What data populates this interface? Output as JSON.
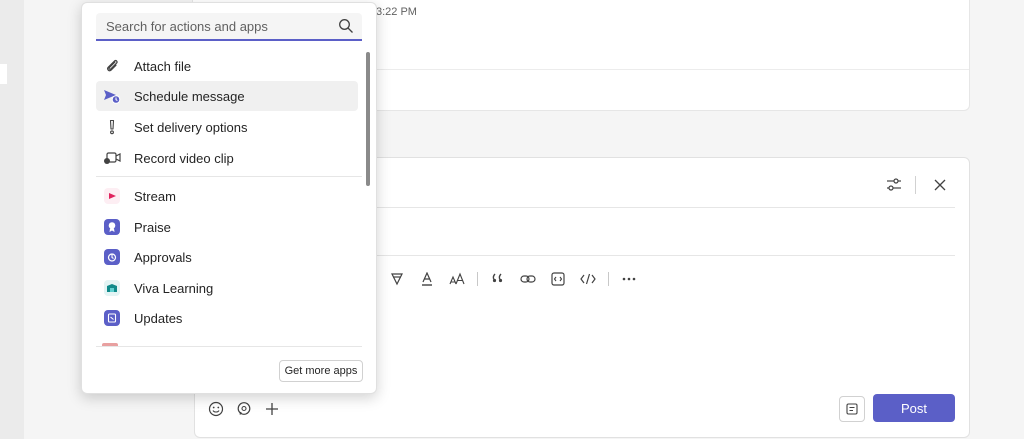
{
  "background": {
    "timestamp": "3:22 PM"
  },
  "popup": {
    "search_placeholder": "Search for actions and apps",
    "actions": [
      {
        "label": "Attach file",
        "icon": "paperclip-icon"
      },
      {
        "label": "Schedule message",
        "icon": "schedule-send-icon"
      },
      {
        "label": "Set delivery options",
        "icon": "exclamation-icon"
      },
      {
        "label": "Record video clip",
        "icon": "video-clip-icon"
      }
    ],
    "apps": [
      {
        "label": "Stream",
        "icon": "stream-icon",
        "color": "#e0245e"
      },
      {
        "label": "Praise",
        "icon": "praise-icon",
        "color": "#5b5fc7"
      },
      {
        "label": "Approvals",
        "icon": "approvals-icon",
        "color": "#5b5fc7"
      },
      {
        "label": "Viva Learning",
        "icon": "viva-learning-icon",
        "color": "#0f8a8a"
      },
      {
        "label": "Updates",
        "icon": "updates-icon",
        "color": "#5b5fc7"
      }
    ],
    "get_more_label": "Get more apps"
  },
  "compose": {
    "post_label": "Post"
  },
  "colors": {
    "accent": "#5b5fc7",
    "hover": "#f0f0f0"
  }
}
